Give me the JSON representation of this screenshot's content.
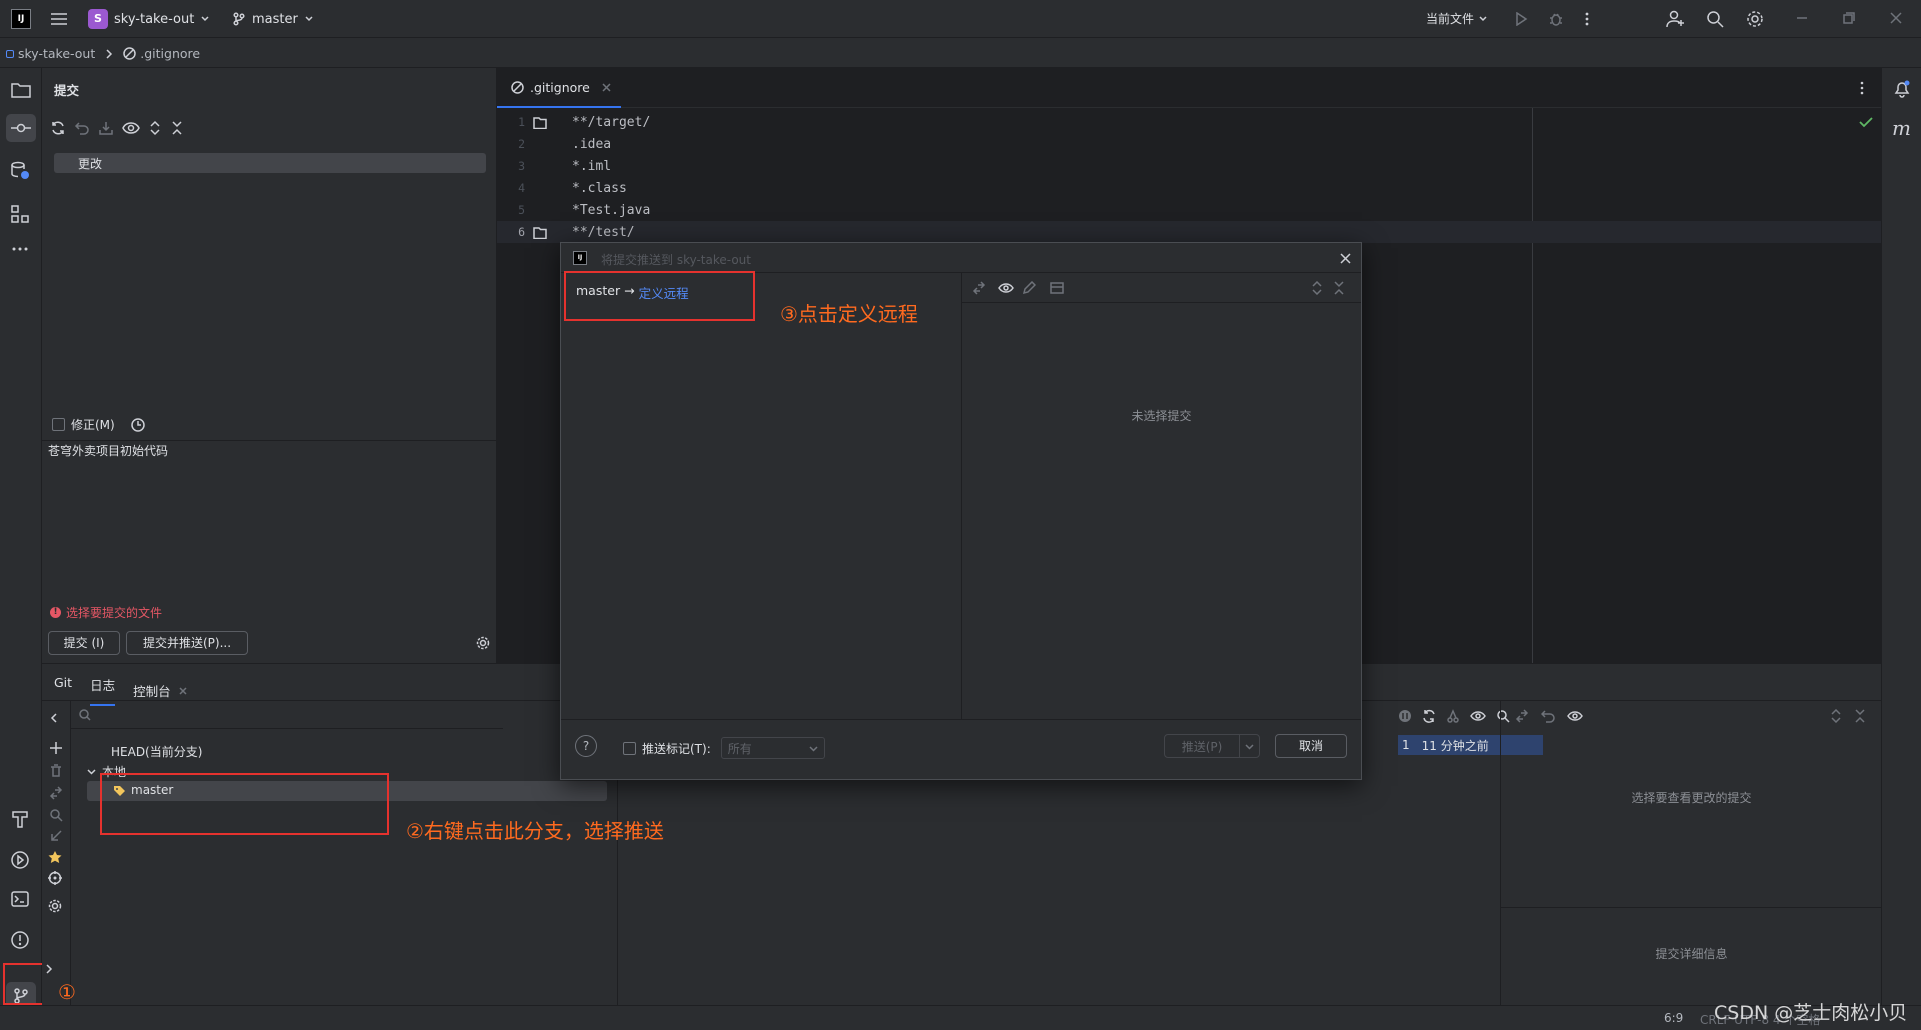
{
  "titlebar": {
    "project_badge": "S",
    "project_name": "sky-take-out",
    "branch": "master",
    "run_config": "当前文件"
  },
  "breadcrumb": {
    "project": "sky-take-out",
    "file": ".gitignore"
  },
  "commit_panel": {
    "title": "提交",
    "changes_group": "更改",
    "amend_label": "修正(M)",
    "message": "苍穹外卖项目初始代码",
    "error": "选择要提交的文件",
    "commit_button": "提交 (I)",
    "commit_push_button": "提交并推送(P)..."
  },
  "editor": {
    "tab_name": ".gitignore",
    "lines": [
      {
        "num": "1",
        "text": "**/target/"
      },
      {
        "num": "2",
        "text": ".idea"
      },
      {
        "num": "3",
        "text": "*.iml"
      },
      {
        "num": "4",
        "text": "*.class"
      },
      {
        "num": "5",
        "text": "*Test.java"
      },
      {
        "num": "6",
        "text": "**/test/"
      }
    ]
  },
  "git_panel": {
    "tabs": [
      "Git",
      "日志",
      "控制台"
    ],
    "head_label": "HEAD(当前分支)",
    "local_label": "本地",
    "branch_item": "master",
    "log_row_author_fragment": "1",
    "log_row_time": "11 分钟之前",
    "details_empty": "选择要查看更改的提交",
    "details_footer": "提交详细信息"
  },
  "dialog": {
    "title": "将提交推送到 sky-take-out",
    "source_branch": "master",
    "arrow": "→",
    "define_remote_link": "定义远程",
    "no_commit_selected": "未选择提交",
    "push_tags_label": "推送标记(T):",
    "push_tags_value": "所有",
    "push_button": "推送(P)",
    "cancel_button": "取消",
    "help": "?"
  },
  "status_bar": {
    "position": "6:9",
    "encoding_fragment": "CRLF  UTF-8  4 个空格"
  },
  "annotations": {
    "step1": "①",
    "step2": "②右键点击此分支，选择推送",
    "step3": "③点击定义远程"
  },
  "watermark": "CSDN @芝士肉松小贝",
  "colors": {
    "accent_link": "#548af7",
    "annotation": "#ff6a1f",
    "highlight_box": "#e5322e",
    "project_badge": "#9b59d0",
    "error": "#e55765"
  }
}
